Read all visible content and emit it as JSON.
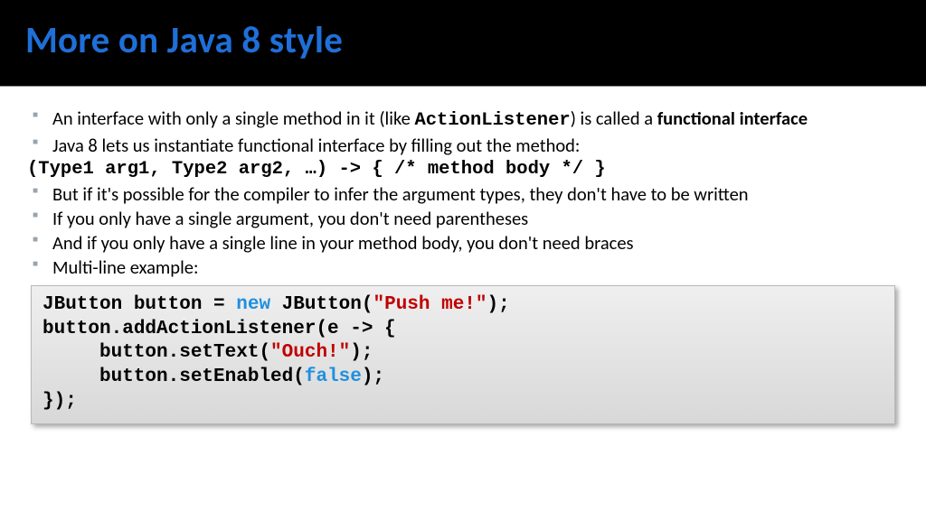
{
  "title": "More on Java 8 style",
  "bullets": {
    "b1_pre": "An interface with only a single method in it (like ",
    "b1_code": "ActionListener",
    "b1_post": ") is called a ",
    "b1_bold": "functional interface",
    "b2": "Java 8 lets us instantiate functional interface by filling out the method:",
    "sig": "(Type1 arg1, Type2 arg2, …) -> { /* method body */  }",
    "b3": "But if it's possible for the compiler to infer the argument types, they don't have to be written",
    "b4": "If you only have a single argument, you don't need parentheses",
    "b5": "And if you only have a single line in your method body, you don't need braces",
    "b6": "Multi-line example:"
  },
  "code": {
    "l1a": "JButton button = ",
    "l1_kw": "new",
    "l1b": " JButton(",
    "l1_str": "\"Push me!\"",
    "l1c": ");",
    "l2": "button.addActionListener(e -> {",
    "l3a": "     button.setText(",
    "l3_str": "\"Ouch!\"",
    "l3b": ");",
    "l4a": "     button.setEnabled(",
    "l4_kw": "false",
    "l4b": ");",
    "l5": "});"
  }
}
